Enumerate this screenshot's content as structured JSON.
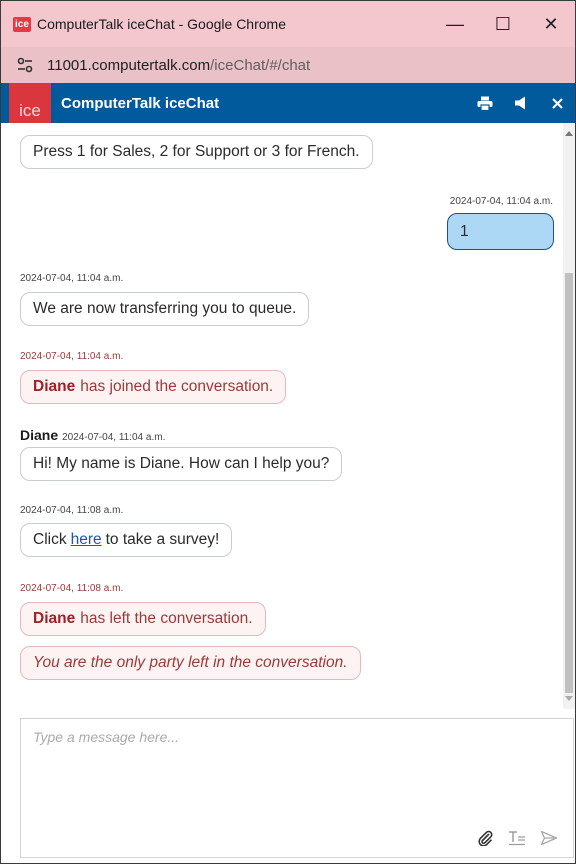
{
  "window": {
    "badge": "ice",
    "title": "ComputerTalk iceChat - Google Chrome",
    "controls": {
      "minimize": "—",
      "maximize": "☐",
      "close": "✕"
    }
  },
  "address": {
    "url_host": "11001.computertalk.com",
    "url_path": "/iceChat/#/chat"
  },
  "chat_header": {
    "logo_text": "ice",
    "title": "ComputerTalk iceChat"
  },
  "messages": {
    "m1": {
      "text": "Press 1 for Sales, 2 for Support or 3 for French."
    },
    "m2": {
      "timestamp": "2024-07-04, 11:04 a.m.",
      "text": "1"
    },
    "m3": {
      "timestamp": "2024-07-04, 11:04 a.m.",
      "text": "We are now transferring you to queue."
    },
    "m4": {
      "timestamp": "2024-07-04, 11:04 a.m.",
      "name": "Diane",
      "text": "has joined the conversation."
    },
    "m5": {
      "sender": "Diane",
      "timestamp": "2024-07-04, 11:04 a.m.",
      "text": "Hi! My name is Diane. How can I help you?"
    },
    "m6": {
      "timestamp": "2024-07-04, 11:08 a.m.",
      "before": "Click",
      "link": "here",
      "after": "to take a survey!"
    },
    "m7": {
      "timestamp": "2024-07-04, 11:08 a.m.",
      "name": "Diane",
      "text": "has left the conversation."
    },
    "m8": {
      "text": "You are the only party left in the conversation."
    }
  },
  "composer": {
    "placeholder": "Type a message here..."
  },
  "colors": {
    "titlebar": "#f4c7ce",
    "header": "#005a9c",
    "logo": "#d9363e",
    "system_text": "#9c3a38",
    "self_bubble": "#add8f5",
    "link": "#1f55a8"
  },
  "icons": {
    "site_info": "tune-icon",
    "print": "print-icon",
    "sound": "speaker-icon",
    "close": "close-icon",
    "attach": "paperclip-icon",
    "format": "text-format-icon",
    "send": "send-icon"
  }
}
